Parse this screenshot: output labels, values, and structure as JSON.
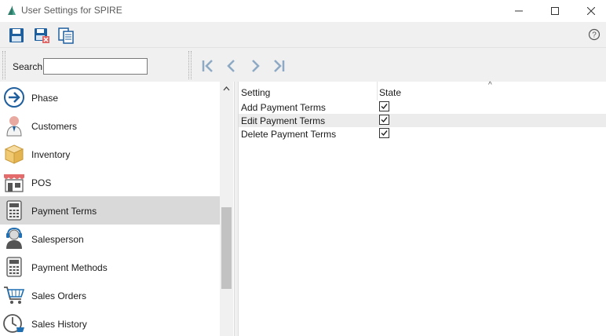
{
  "window": {
    "title": "User Settings for SPIRE",
    "minimize_glyph": "—",
    "maximize_glyph": "☐",
    "close_glyph": "✕"
  },
  "toolbar": {
    "icons": [
      "save-icon",
      "save-close-icon",
      "copy-icon",
      "help-icon"
    ]
  },
  "search": {
    "label": "Search",
    "value": ""
  },
  "nav": {
    "icons": [
      "first-record-icon",
      "previous-record-icon",
      "next-record-icon",
      "last-record-icon"
    ]
  },
  "sidebar": {
    "items": [
      {
        "label": "Phase",
        "icon": "arrow-right-circle-icon",
        "selected": false
      },
      {
        "label": "Customers",
        "icon": "customer-person-icon",
        "selected": false
      },
      {
        "label": "Inventory",
        "icon": "box-icon",
        "selected": false
      },
      {
        "label": "POS",
        "icon": "storefront-icon",
        "selected": false
      },
      {
        "label": "Payment Terms",
        "icon": "calculator-icon",
        "selected": true
      },
      {
        "label": "Salesperson",
        "icon": "headset-person-icon",
        "selected": false
      },
      {
        "label": "Payment Methods",
        "icon": "calculator-icon",
        "selected": false
      },
      {
        "label": "Sales Orders",
        "icon": "shopping-cart-icon",
        "selected": false
      },
      {
        "label": "Sales History",
        "icon": "clock-cart-icon",
        "selected": false
      }
    ]
  },
  "grid": {
    "columns": [
      "Setting",
      "State"
    ],
    "sort_indicator": "^",
    "rows": [
      {
        "setting": "Add Payment Terms",
        "checked": true
      },
      {
        "setting": "Edit Payment Terms",
        "checked": true
      },
      {
        "setting": "Delete Payment Terms",
        "checked": true
      }
    ]
  },
  "colors": {
    "accent_blue": "#1f6fb2",
    "selected_row": "#d9d9d9",
    "toolbar_bg": "#f0f0f0"
  }
}
